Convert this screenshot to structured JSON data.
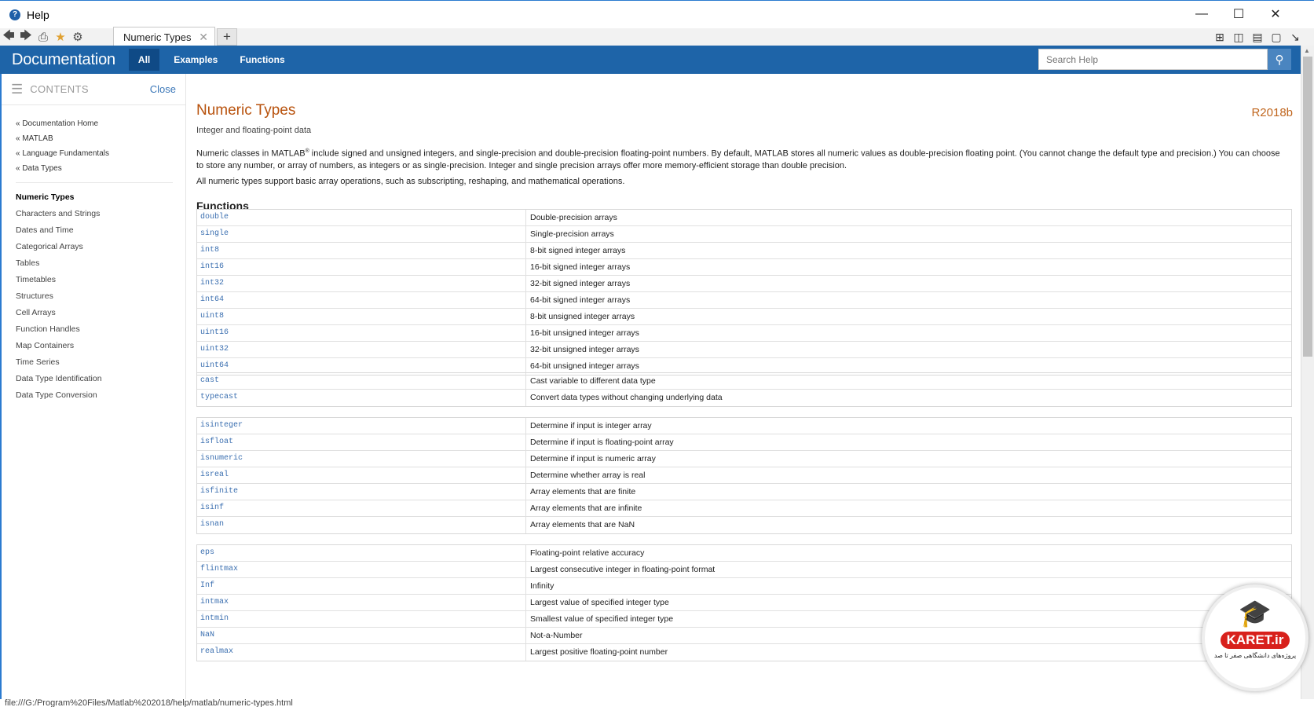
{
  "window": {
    "title": "Help",
    "tab_label": "Numeric Types"
  },
  "header": {
    "brand": "Documentation",
    "tabs": [
      "All",
      "Examples",
      "Functions"
    ],
    "search_placeholder": "Search Help"
  },
  "sidebar": {
    "contents_label": "CONTENTS",
    "close_label": "Close",
    "breadcrumbs": [
      "« Documentation Home",
      "« MATLAB",
      "« Language Fundamentals",
      "« Data Types"
    ],
    "items": [
      "Numeric Types",
      "Characters and Strings",
      "Dates and Time",
      "Categorical Arrays",
      "Tables",
      "Timetables",
      "Structures",
      "Cell Arrays",
      "Function Handles",
      "Map Containers",
      "Time Series",
      "Data Type Identification",
      "Data Type Conversion"
    ]
  },
  "page": {
    "title": "Numeric Types",
    "release": "R2018b",
    "subtitle": "Integer and floating-point data",
    "para1_a": "Numeric classes in MATLAB",
    "para1_sup": "®",
    "para1_b": " include signed and unsigned integers, and single-precision and double-precision floating-point numbers. By default, MATLAB stores all numeric values as double-precision floating point. (You cannot change the default type and precision.) You can choose to store any number, or array of numbers, as integers or as single-precision. Integer and single precision arrays offer more memory-efficient storage than double precision.",
    "para2": "All numeric types support basic array operations, such as subscripting, reshaping, and mathematical operations.",
    "functions_heading": "Functions"
  },
  "function_groups": [
    [
      [
        "double",
        "Double-precision arrays"
      ],
      [
        "single",
        "Single-precision arrays"
      ],
      [
        "int8",
        "8-bit signed integer arrays"
      ],
      [
        "int16",
        "16-bit signed integer arrays"
      ],
      [
        "int32",
        "32-bit signed integer arrays"
      ],
      [
        "int64",
        "64-bit signed integer arrays"
      ],
      [
        "uint8",
        "8-bit unsigned integer arrays"
      ],
      [
        "uint16",
        "16-bit unsigned integer arrays"
      ],
      [
        "uint32",
        "32-bit unsigned integer arrays"
      ],
      [
        "uint64",
        "64-bit unsigned integer arrays"
      ]
    ],
    [
      [
        "cast",
        "Cast variable to different data type"
      ],
      [
        "typecast",
        "Convert data types without changing underlying data"
      ]
    ],
    [
      [
        "isinteger",
        "Determine if input is integer array"
      ],
      [
        "isfloat",
        "Determine if input is floating-point array"
      ],
      [
        "isnumeric",
        "Determine if input is numeric array"
      ],
      [
        "isreal",
        "Determine whether array is real"
      ],
      [
        "isfinite",
        "Array elements that are finite"
      ],
      [
        "isinf",
        "Array elements that are infinite"
      ],
      [
        "isnan",
        "Array elements that are NaN"
      ]
    ],
    [
      [
        "eps",
        "Floating-point relative accuracy"
      ],
      [
        "flintmax",
        "Largest consecutive integer in floating-point format"
      ],
      [
        "Inf",
        "Infinity"
      ],
      [
        "intmax",
        "Largest value of specified integer type"
      ],
      [
        "intmin",
        "Smallest value of specified integer type"
      ],
      [
        "NaN",
        "Not-a-Number"
      ],
      [
        "realmax",
        "Largest positive floating-point number"
      ]
    ]
  ],
  "status_url": "file:///G:/Program%20Files/Matlab%202018/help/matlab/numeric-types.html",
  "watermark": {
    "text": "KARET.ir",
    "subtitle": "پروژه‌های دانشگاهی صفر تا صد"
  },
  "colors": {
    "header_blue": "#1e64a8",
    "title_orange": "#b8520d",
    "link_blue": "#3b6fb0"
  }
}
